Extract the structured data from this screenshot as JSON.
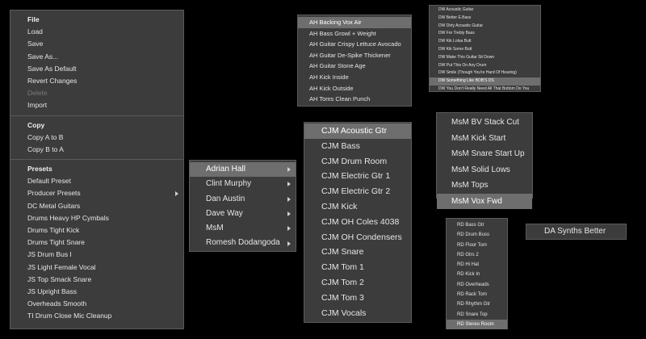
{
  "file_menu": {
    "file_header": "File",
    "file_items": [
      {
        "label": "Load"
      },
      {
        "label": "Save"
      },
      {
        "label": "Save As..."
      },
      {
        "label": "Save As Default"
      },
      {
        "label": "Revert Changes"
      },
      {
        "label": "Delete",
        "disabled": true
      },
      {
        "label": "Import"
      }
    ],
    "copy_header": "Copy",
    "copy_items": [
      {
        "label": "Copy A to B"
      },
      {
        "label": "Copy B to A"
      }
    ],
    "presets_header": "Presets",
    "preset_items": [
      {
        "label": "Default Preset"
      },
      {
        "label": "Producer Presets",
        "submenu": true
      },
      {
        "label": "DC Metal Guitars"
      },
      {
        "label": "Drums Heavy HP Cymbals"
      },
      {
        "label": "Drums Tight Kick"
      },
      {
        "label": "Drums Tight Snare"
      },
      {
        "label": "JS Drum Bus I"
      },
      {
        "label": "JS Light Female Vocal"
      },
      {
        "label": "JS Top Smack Snare"
      },
      {
        "label": "JS Upright Bass"
      },
      {
        "label": "Overheads Smooth"
      },
      {
        "label": "TI Drum Close Mic Cleanup"
      }
    ]
  },
  "producers_menu": {
    "items": [
      {
        "label": "Adrian Hall",
        "submenu": true,
        "selected": true
      },
      {
        "label": "Clint Murphy",
        "submenu": true
      },
      {
        "label": "Dan Austin",
        "submenu": true
      },
      {
        "label": "Dave Way",
        "submenu": true
      },
      {
        "label": "MsM",
        "submenu": true
      },
      {
        "label": "Romesh Dodangoda",
        "submenu": true
      }
    ]
  },
  "ah_menu": {
    "items": [
      {
        "label": "AH Backing Vox Air",
        "selected": true
      },
      {
        "label": "AH Bass Growl + Weight"
      },
      {
        "label": "AH Guitar Crispy Lettuce Avocado"
      },
      {
        "label": "AH Guitar De-Spike Thickener"
      },
      {
        "label": "AH Guitar Stone Age"
      },
      {
        "label": "AH Kick Inside"
      },
      {
        "label": "AH Kick Outside"
      },
      {
        "label": "AH Toms Clean Punch"
      }
    ]
  },
  "dw_menu": {
    "items": [
      {
        "label": "DW Acoustic Guitar"
      },
      {
        "label": "DW Better E.Bass"
      },
      {
        "label": "DW Dirty Acoustic Guitar"
      },
      {
        "label": "DW For Trebly Bass"
      },
      {
        "label": "DW Kik Lotsa Butt"
      },
      {
        "label": "DW Kik Some Butt"
      },
      {
        "label": "DW Make This Guitar Sit Down"
      },
      {
        "label": "DW Put This On Any Drum"
      },
      {
        "label": "DW Smile (Though You're Hard Of Hearing)"
      },
      {
        "label": "DW Something Like BOB'S DS",
        "selected": true
      },
      {
        "label": "DW You Don't Really Need All That Bottom Do You"
      }
    ]
  },
  "cjm_menu": {
    "items": [
      {
        "label": "CJM Acoustic Gtr",
        "selected": true
      },
      {
        "label": "CJM Bass"
      },
      {
        "label": "CJM Drum Room"
      },
      {
        "label": "CJM Electric Gtr 1"
      },
      {
        "label": "CJM Electric Gtr 2"
      },
      {
        "label": "CJM Kick"
      },
      {
        "label": "CJM OH Coles 4038"
      },
      {
        "label": "CJM OH Condensers"
      },
      {
        "label": "CJM Snare"
      },
      {
        "label": "CJM Tom 1"
      },
      {
        "label": "CJM Tom 2"
      },
      {
        "label": "CJM Tom 3"
      },
      {
        "label": "CJM Vocals"
      }
    ]
  },
  "msm_menu": {
    "items": [
      {
        "label": "MsM BV Stack Cut"
      },
      {
        "label": "MsM Kick Start"
      },
      {
        "label": "MsM Snare Start Up"
      },
      {
        "label": "MsM Solid Lows"
      },
      {
        "label": "MsM Tops"
      },
      {
        "label": "MsM Vox Fwd",
        "selected": true
      }
    ]
  },
  "rd_menu": {
    "items": [
      {
        "label": "RD Bass Gtr"
      },
      {
        "label": "RD Drum Buss"
      },
      {
        "label": "RD Floor Tom"
      },
      {
        "label": "RD Gtrs 2"
      },
      {
        "label": "RD Hi Hat"
      },
      {
        "label": "RD Kick In"
      },
      {
        "label": "RD Overheads"
      },
      {
        "label": "RD Rack Tom"
      },
      {
        "label": "RD Rhythm Gtr"
      },
      {
        "label": "RD Snare Top"
      },
      {
        "label": "RD Stereo Room",
        "selected": true
      }
    ]
  },
  "da_menu": {
    "items": [
      {
        "label": "DA Synths Better"
      }
    ]
  }
}
